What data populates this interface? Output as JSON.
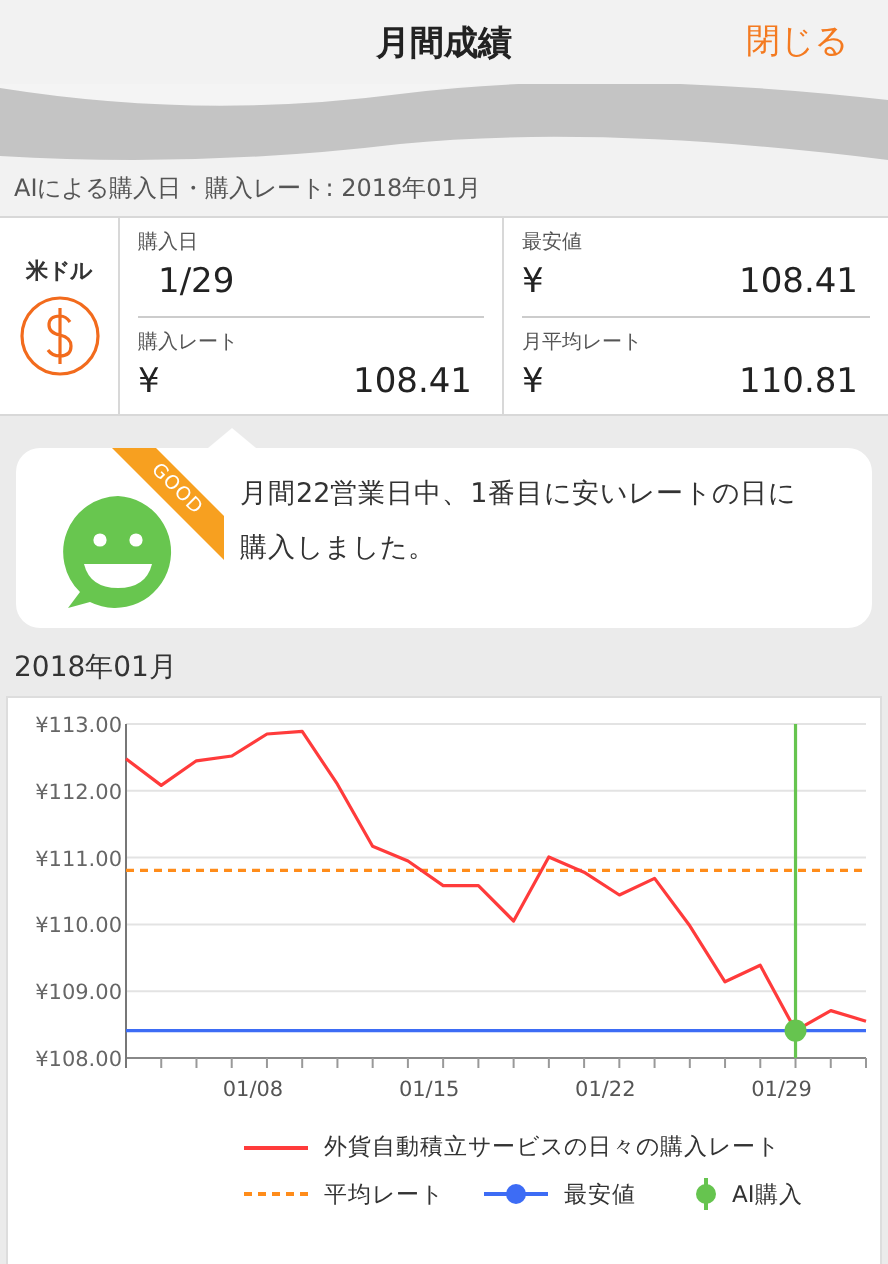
{
  "header": {
    "title": "月間成績",
    "close": "閉じる"
  },
  "subtitle": "AIによる購入日・購入レート: 2018年01月",
  "currency": {
    "label": "米ドル"
  },
  "stats": [
    {
      "label": "購入日",
      "value": "1/29"
    },
    {
      "label": "最安値",
      "currency": "¥",
      "value": "108.41"
    },
    {
      "label": "購入レート",
      "currency": "¥",
      "value": "108.41"
    },
    {
      "label": "月平均レート",
      "currency": "¥",
      "value": "110.81"
    }
  ],
  "message": {
    "badge": "GOOD",
    "text": "月間22営業日中、1番目に安いレートの日に購入しました。"
  },
  "chart_section": {
    "title": "2018年01月",
    "chart_data": {
      "type": "line",
      "categories": [
        null,
        null,
        null,
        null,
        "01/08",
        null,
        null,
        null,
        null,
        "01/15",
        null,
        null,
        null,
        null,
        "01/22",
        null,
        null,
        null,
        null,
        "01/29",
        null,
        null
      ],
      "ylim": [
        108,
        113
      ],
      "yticks": [
        {
          "value": 108,
          "label": "¥108.00"
        },
        {
          "value": 109,
          "label": "¥109.00"
        },
        {
          "value": 110,
          "label": "¥110.00"
        },
        {
          "value": 111,
          "label": "¥111.00"
        },
        {
          "value": 112,
          "label": "¥112.00"
        },
        {
          "value": 113,
          "label": "¥113.00"
        }
      ],
      "series": [
        {
          "name": "外貨自動積立サービスの日々の購入レート",
          "color": "#ff3b3b",
          "values": [
            112.48,
            112.08,
            112.45,
            112.52,
            112.85,
            112.89,
            112.1,
            111.17,
            110.95,
            110.58,
            110.58,
            110.05,
            111.01,
            110.78,
            110.44,
            110.69,
            109.98,
            109.14,
            109.39,
            108.41,
            108.71,
            108.55
          ]
        }
      ],
      "ref_lines": [
        {
          "axis": "y",
          "value": 110.81,
          "label": "平均レート",
          "color": "#ff8c1a"
        },
        {
          "axis": "y",
          "value": 108.41,
          "label": "最安値",
          "color": "#3d6cf5"
        },
        {
          "axis": "x",
          "value": "01/29",
          "label": "AI購入",
          "color": "#66c44f"
        }
      ],
      "grid": true,
      "legend": true
    }
  }
}
